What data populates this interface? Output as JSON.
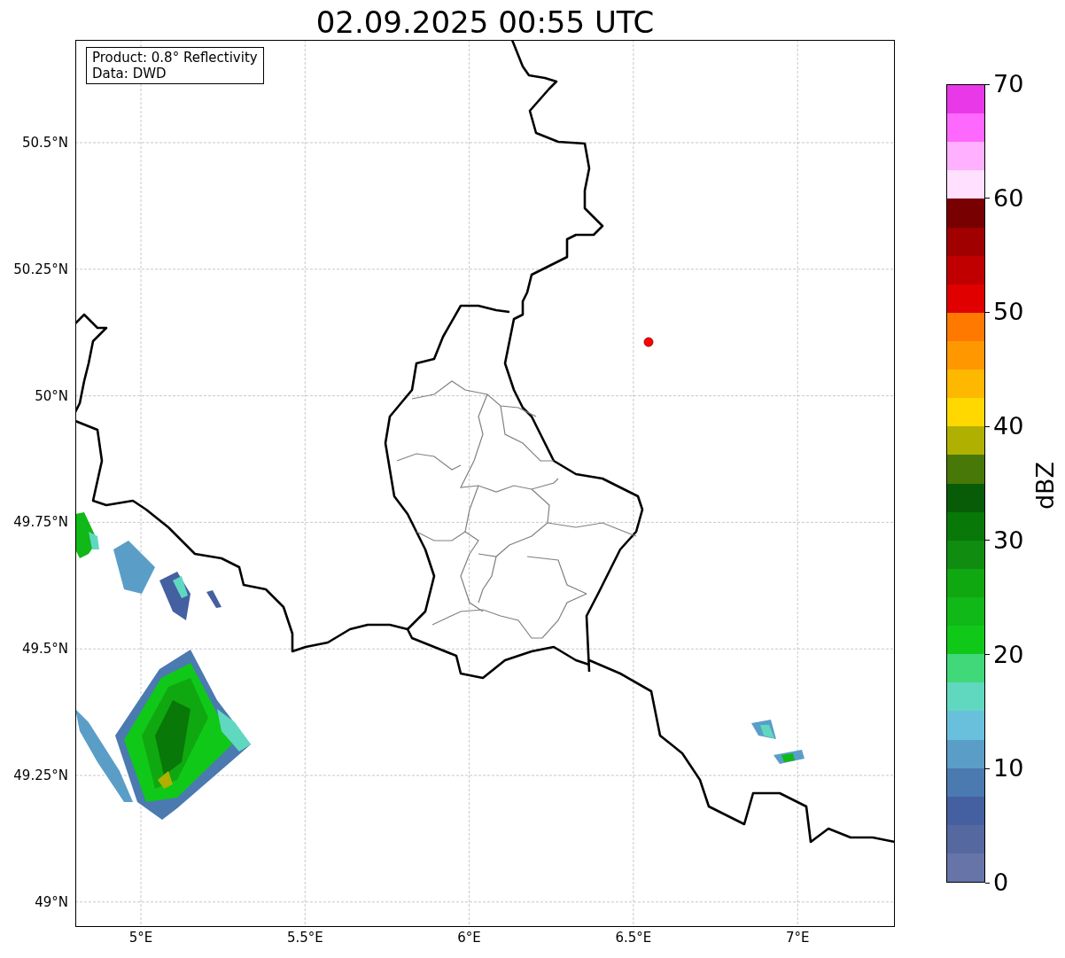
{
  "title": "02.09.2025 00:55 UTC",
  "info_box": [
    "Product: 0.8° Reflectivity",
    "Data: DWD"
  ],
  "map": {
    "y_axis_labels": [
      "50.5°N",
      "50.25°N",
      "50°N",
      "49.75°N",
      "49.5°N",
      "49.25°N",
      "49°N"
    ],
    "x_axis_labels": [
      "5°E",
      "5.5°E",
      "6°E",
      "6.5°E",
      "7°E"
    ]
  },
  "colorbar": {
    "label": "dBZ",
    "ticks": [
      "70",
      "60",
      "50",
      "40",
      "30",
      "20",
      "10",
      "0"
    ],
    "bands": [
      {
        "color": "#e838e8"
      },
      {
        "color": "#ff68ff"
      },
      {
        "color": "#ffb0ff"
      },
      {
        "color": "#ffe0ff"
      },
      {
        "color": "#780000"
      },
      {
        "color": "#a00000"
      },
      {
        "color": "#c00000"
      },
      {
        "color": "#e00000"
      },
      {
        "color": "#ff7800"
      },
      {
        "color": "#ff9800"
      },
      {
        "color": "#ffb800"
      },
      {
        "color": "#ffd800"
      },
      {
        "color": "#b0b000"
      },
      {
        "color": "#487808"
      },
      {
        "color": "#085c08"
      },
      {
        "color": "#087808"
      },
      {
        "color": "#108c10"
      },
      {
        "color": "#10a810"
      },
      {
        "color": "#10b818"
      },
      {
        "color": "#10c818"
      },
      {
        "color": "#40d878"
      },
      {
        "color": "#60d8c0"
      },
      {
        "color": "#68c0dc"
      },
      {
        "color": "#5a9ec8"
      },
      {
        "color": "#4a7ab0"
      },
      {
        "color": "#4460a0"
      },
      {
        "color": "#5568a0"
      },
      {
        "color": "#6674a8"
      }
    ]
  }
}
